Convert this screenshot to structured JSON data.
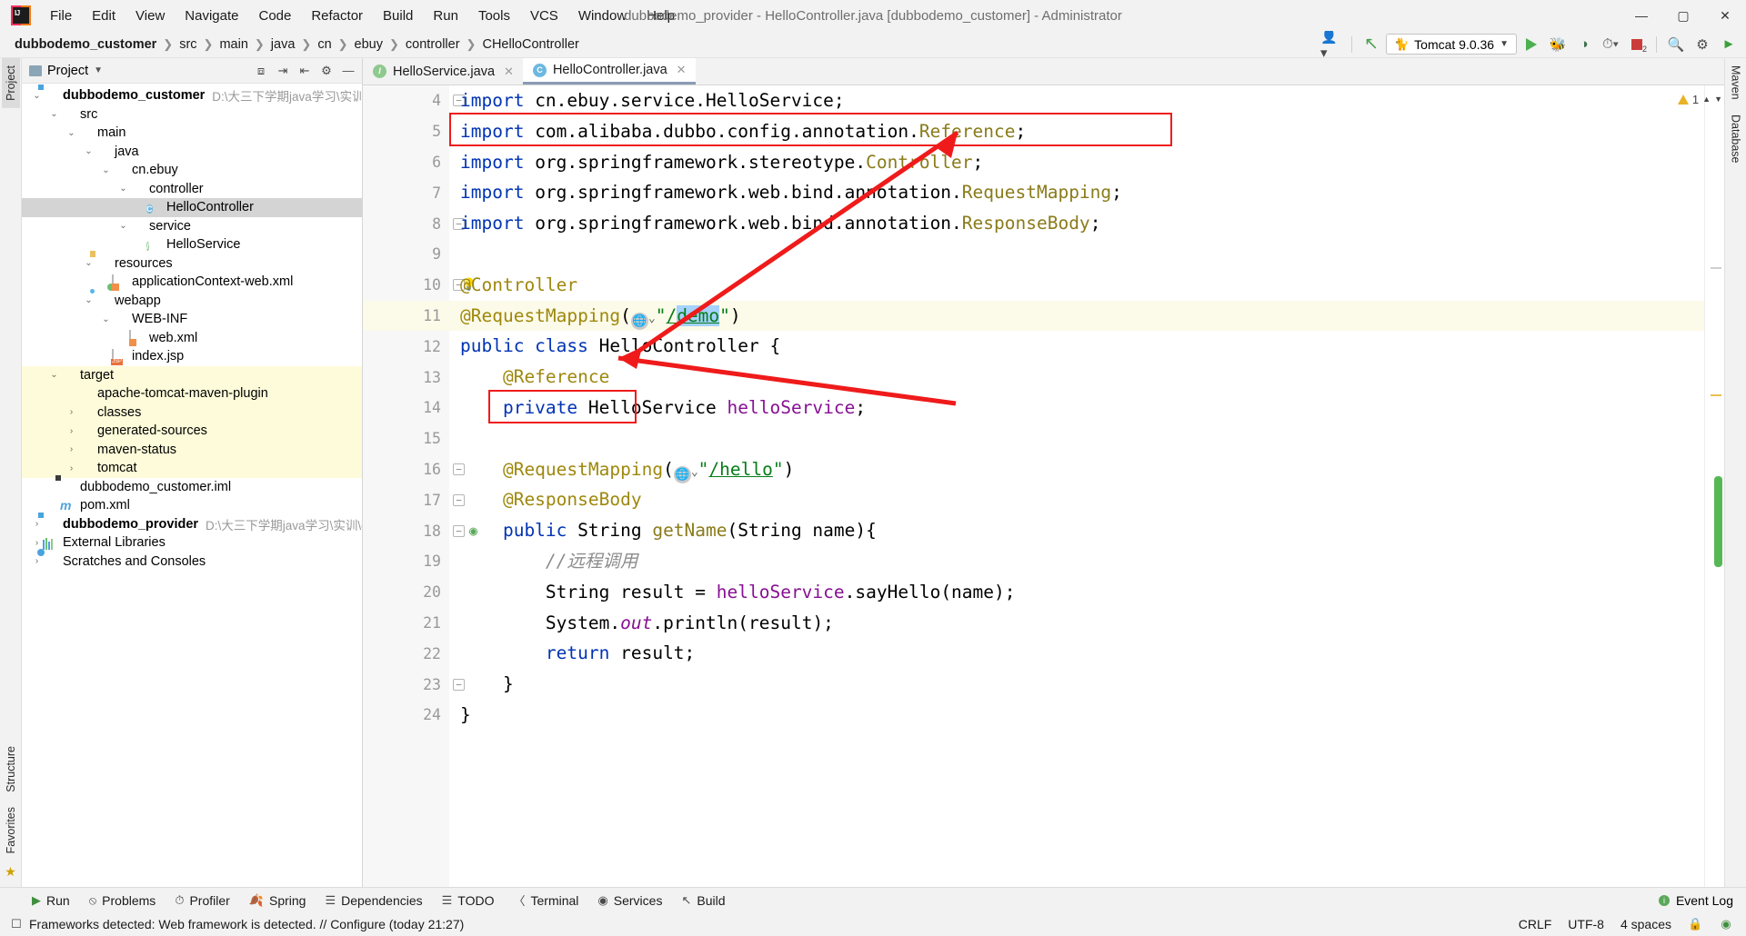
{
  "window": {
    "title": "dubbodemo_provider - HelloController.java [dubbodemo_customer] - Administrator",
    "minimize": "—",
    "maximize": "▢",
    "close": "✕"
  },
  "menu": [
    {
      "label": "File"
    },
    {
      "label": "Edit"
    },
    {
      "label": "View"
    },
    {
      "label": "Navigate"
    },
    {
      "label": "Code"
    },
    {
      "label": "Refactor"
    },
    {
      "label": "Build"
    },
    {
      "label": "Run"
    },
    {
      "label": "Tools"
    },
    {
      "label": "VCS"
    },
    {
      "label": "Window"
    },
    {
      "label": "Help"
    }
  ],
  "breadcrumb": [
    {
      "label": "dubbodemo_customer",
      "bold": true
    },
    {
      "label": "src"
    },
    {
      "label": "main"
    },
    {
      "label": "java"
    },
    {
      "label": "cn"
    },
    {
      "label": "ebuy"
    },
    {
      "label": "controller"
    },
    {
      "label": "HelloController",
      "icon": "C"
    }
  ],
  "toolbar": {
    "user_icon": "user-icon",
    "update_icon": "update-project-icon",
    "run_config": "Tomcat 9.0.36",
    "run_label": "run-button",
    "debug_label": "debug-button",
    "coverage_label": "run-with-coverage-button",
    "profile_label": "profiler-button",
    "stop_label": "stop-button",
    "stop_badge": "2",
    "search_label": "search-everywhere-button",
    "settings_label": "settings-button",
    "plugin_label": "ide-assistant-button"
  },
  "project_panel": {
    "title": "Project",
    "header_icons": [
      "collapse-scope-icon",
      "expand-all-icon",
      "collapse-all-icon",
      "gear-icon",
      "hide-icon"
    ],
    "tree": [
      {
        "depth": 0,
        "arrow": "v",
        "icon": "module",
        "label": "dubbodemo_customer",
        "bold": true,
        "path": "D:\\大三下学期java学习\\实训\\dub"
      },
      {
        "depth": 1,
        "arrow": "v",
        "icon": "folder",
        "label": "src"
      },
      {
        "depth": 2,
        "arrow": "v",
        "icon": "folder",
        "label": "main"
      },
      {
        "depth": 3,
        "arrow": "v",
        "icon": "folder-blue",
        "label": "java"
      },
      {
        "depth": 4,
        "arrow": "v",
        "icon": "package",
        "label": "cn.ebuy"
      },
      {
        "depth": 5,
        "arrow": "v",
        "icon": "package",
        "label": "controller"
      },
      {
        "depth": 6,
        "arrow": "",
        "icon": "class",
        "label": "HelloController",
        "selected": true
      },
      {
        "depth": 5,
        "arrow": "v",
        "icon": "package",
        "label": "service"
      },
      {
        "depth": 6,
        "arrow": "",
        "icon": "interface",
        "label": "HelloService"
      },
      {
        "depth": 3,
        "arrow": "v",
        "icon": "resources",
        "label": "resources"
      },
      {
        "depth": 4,
        "arrow": "",
        "icon": "xml-spring",
        "label": "applicationContext-web.xml"
      },
      {
        "depth": 3,
        "arrow": "v",
        "icon": "webapp",
        "label": "webapp"
      },
      {
        "depth": 4,
        "arrow": "v",
        "icon": "folder",
        "label": "WEB-INF"
      },
      {
        "depth": 5,
        "arrow": "",
        "icon": "xml-web",
        "label": "web.xml"
      },
      {
        "depth": 4,
        "arrow": "",
        "icon": "jsp",
        "label": "index.jsp"
      },
      {
        "depth": 1,
        "arrow": "v",
        "icon": "folder-orange",
        "label": "target",
        "excluded": true
      },
      {
        "depth": 2,
        "arrow": "",
        "icon": "folder-orange",
        "label": "apache-tomcat-maven-plugin",
        "excluded": true
      },
      {
        "depth": 2,
        "arrow": ">",
        "icon": "folder-orange",
        "label": "classes",
        "excluded": true
      },
      {
        "depth": 2,
        "arrow": ">",
        "icon": "folder-orange",
        "label": "generated-sources",
        "excluded": true
      },
      {
        "depth": 2,
        "arrow": ">",
        "icon": "folder-orange",
        "label": "maven-status",
        "excluded": true
      },
      {
        "depth": 2,
        "arrow": ">",
        "icon": "folder-orange",
        "label": "tomcat",
        "excluded": true
      },
      {
        "depth": 1,
        "arrow": "",
        "icon": "iml",
        "label": "dubbodemo_customer.iml"
      },
      {
        "depth": 1,
        "arrow": "",
        "icon": "maven",
        "label": "pom.xml"
      },
      {
        "depth": 0,
        "arrow": ">",
        "icon": "module",
        "label": "dubbodemo_provider",
        "bold": true,
        "path": "D:\\大三下学期java学习\\实训\\dubb"
      },
      {
        "depth": 0,
        "arrow": ">",
        "icon": "library",
        "label": "External Libraries"
      },
      {
        "depth": 0,
        "arrow": ">",
        "icon": "scratches",
        "label": "Scratches and Consoles"
      }
    ]
  },
  "left_stripe": [
    {
      "label": "Project",
      "active": true
    },
    {
      "label": "Structure",
      "active": false
    },
    {
      "label": "Favorites",
      "active": false
    }
  ],
  "right_stripe": [
    {
      "label": "Maven"
    },
    {
      "label": "Database"
    }
  ],
  "editor_tabs": [
    {
      "label": "HelloService.java",
      "icon": "interface",
      "active": false,
      "close": "✕"
    },
    {
      "label": "HelloController.java",
      "icon": "class",
      "active": true,
      "close": "✕"
    }
  ],
  "editor": {
    "warning_count": "1",
    "line_numbers": [
      4,
      5,
      6,
      7,
      8,
      9,
      10,
      11,
      12,
      13,
      14,
      15,
      16,
      17,
      18,
      19,
      20,
      21,
      22,
      23,
      24
    ],
    "current_line": 11,
    "lines": [
      {
        "n": 4,
        "tokens": [
          {
            "t": "import ",
            "c": "kw"
          },
          {
            "t": "cn.ebuy.service.HelloService;",
            "c": "plain"
          }
        ],
        "fold": "minus"
      },
      {
        "n": 5,
        "tokens": [
          {
            "t": "import ",
            "c": "kw"
          },
          {
            "t": "com.alibaba.dubbo.config.annotation.",
            "c": "plain"
          },
          {
            "t": "Reference",
            "c": "typ"
          },
          {
            "t": ";",
            "c": "plain"
          }
        ]
      },
      {
        "n": 6,
        "tokens": [
          {
            "t": "import ",
            "c": "kw"
          },
          {
            "t": "org.springframework.stereotype.",
            "c": "plain"
          },
          {
            "t": "Controller",
            "c": "typ"
          },
          {
            "t": ";",
            "c": "plain"
          }
        ]
      },
      {
        "n": 7,
        "tokens": [
          {
            "t": "import ",
            "c": "kw"
          },
          {
            "t": "org.springframework.web.bind.annotation.",
            "c": "plain"
          },
          {
            "t": "RequestMapping",
            "c": "typ"
          },
          {
            "t": ";",
            "c": "plain"
          }
        ]
      },
      {
        "n": 8,
        "tokens": [
          {
            "t": "import ",
            "c": "kw"
          },
          {
            "t": "org.springframework.web.bind.annotation.",
            "c": "plain"
          },
          {
            "t": "ResponseBody",
            "c": "typ"
          },
          {
            "t": ";",
            "c": "plain"
          }
        ],
        "fold": "minus"
      },
      {
        "n": 9,
        "tokens": []
      },
      {
        "n": 10,
        "tokens": [
          {
            "t": "@Controller",
            "c": "ann"
          }
        ],
        "fold": "minus",
        "bulb": true
      },
      {
        "n": 11,
        "tokens": [
          {
            "t": "@RequestMapping",
            "c": "ann"
          },
          {
            "t": "(",
            "c": "plain"
          },
          {
            "t": "GLOBE",
            "c": "globe"
          },
          {
            "t": "\"",
            "c": "str"
          },
          {
            "t": "/",
            "c": "link"
          },
          {
            "t": "demo",
            "c": "link-sel"
          },
          {
            "t": "\"",
            "c": "str"
          },
          {
            "t": ")",
            "c": "plain"
          }
        ],
        "fold": "minus",
        "current": true
      },
      {
        "n": 12,
        "tokens": [
          {
            "t": "public class ",
            "c": "kw"
          },
          {
            "t": "HelloController {",
            "c": "plain"
          }
        ]
      },
      {
        "n": 13,
        "tokens": [
          {
            "t": "    @Reference",
            "c": "ann"
          }
        ]
      },
      {
        "n": 14,
        "tokens": [
          {
            "t": "    private ",
            "c": "kw"
          },
          {
            "t": "HelloService ",
            "c": "plain"
          },
          {
            "t": "helloService",
            "c": "fld"
          },
          {
            "t": ";",
            "c": "plain"
          }
        ]
      },
      {
        "n": 15,
        "tokens": []
      },
      {
        "n": 16,
        "tokens": [
          {
            "t": "    @RequestMapping",
            "c": "ann"
          },
          {
            "t": "(",
            "c": "plain"
          },
          {
            "t": "GLOBE",
            "c": "globe"
          },
          {
            "t": "\"",
            "c": "str"
          },
          {
            "t": "/hello",
            "c": "link"
          },
          {
            "t": "\"",
            "c": "str"
          },
          {
            "t": ")",
            "c": "plain"
          }
        ],
        "fold": "minus"
      },
      {
        "n": 17,
        "tokens": [
          {
            "t": "    @ResponseBody",
            "c": "ann"
          }
        ],
        "fold": "minus"
      },
      {
        "n": 18,
        "tokens": [
          {
            "t": "    public ",
            "c": "kw"
          },
          {
            "t": "String ",
            "c": "plain"
          },
          {
            "t": "getName",
            "c": "typ"
          },
          {
            "t": "(String name){",
            "c": "plain"
          }
        ],
        "fold": "minus",
        "marker": "dubbo"
      },
      {
        "n": 19,
        "tokens": [
          {
            "t": "        //远程调用",
            "c": "cmt"
          }
        ]
      },
      {
        "n": 20,
        "tokens": [
          {
            "t": "        String result = ",
            "c": "plain"
          },
          {
            "t": "helloService",
            "c": "fld"
          },
          {
            "t": ".sayHello(name);",
            "c": "plain"
          }
        ]
      },
      {
        "n": 21,
        "tokens": [
          {
            "t": "        System.",
            "c": "plain"
          },
          {
            "t": "out",
            "c": "stat"
          },
          {
            "t": ".println(result);",
            "c": "plain"
          }
        ]
      },
      {
        "n": 22,
        "tokens": [
          {
            "t": "        return ",
            "c": "kw"
          },
          {
            "t": "result;",
            "c": "plain"
          }
        ]
      },
      {
        "n": 23,
        "tokens": [
          {
            "t": "    }",
            "c": "plain"
          }
        ],
        "fold": "minus"
      },
      {
        "n": 24,
        "tokens": [
          {
            "t": "}",
            "c": "plain"
          }
        ]
      }
    ]
  },
  "annotations": {
    "box_import_label": "red-highlight-import-reference",
    "box_reference_label": "red-highlight-reference-annotation",
    "arrow_color": "#ef1b1b"
  },
  "tool_windows": [
    {
      "label": "Run",
      "icon": "run-icon"
    },
    {
      "label": "Problems",
      "icon": "problems-icon"
    },
    {
      "label": "Profiler",
      "icon": "profiler-icon"
    },
    {
      "label": "Spring",
      "icon": "spring-icon"
    },
    {
      "label": "Dependencies",
      "icon": "dependencies-icon"
    },
    {
      "label": "TODO",
      "icon": "todo-icon"
    },
    {
      "label": "Terminal",
      "icon": "terminal-icon"
    },
    {
      "label": "Services",
      "icon": "services-icon"
    },
    {
      "label": "Build",
      "icon": "build-icon"
    }
  ],
  "event_log": {
    "label": "Event Log",
    "icon": "event-log-icon"
  },
  "status_bar": {
    "message": "Frameworks detected: Web framework is detected. // Configure (today 21:27)",
    "line_separator": "CRLF",
    "encoding": "UTF-8",
    "indent": "4 spaces",
    "lock_icon": "lock-icon",
    "inspection_icon": "inspection-icon"
  }
}
